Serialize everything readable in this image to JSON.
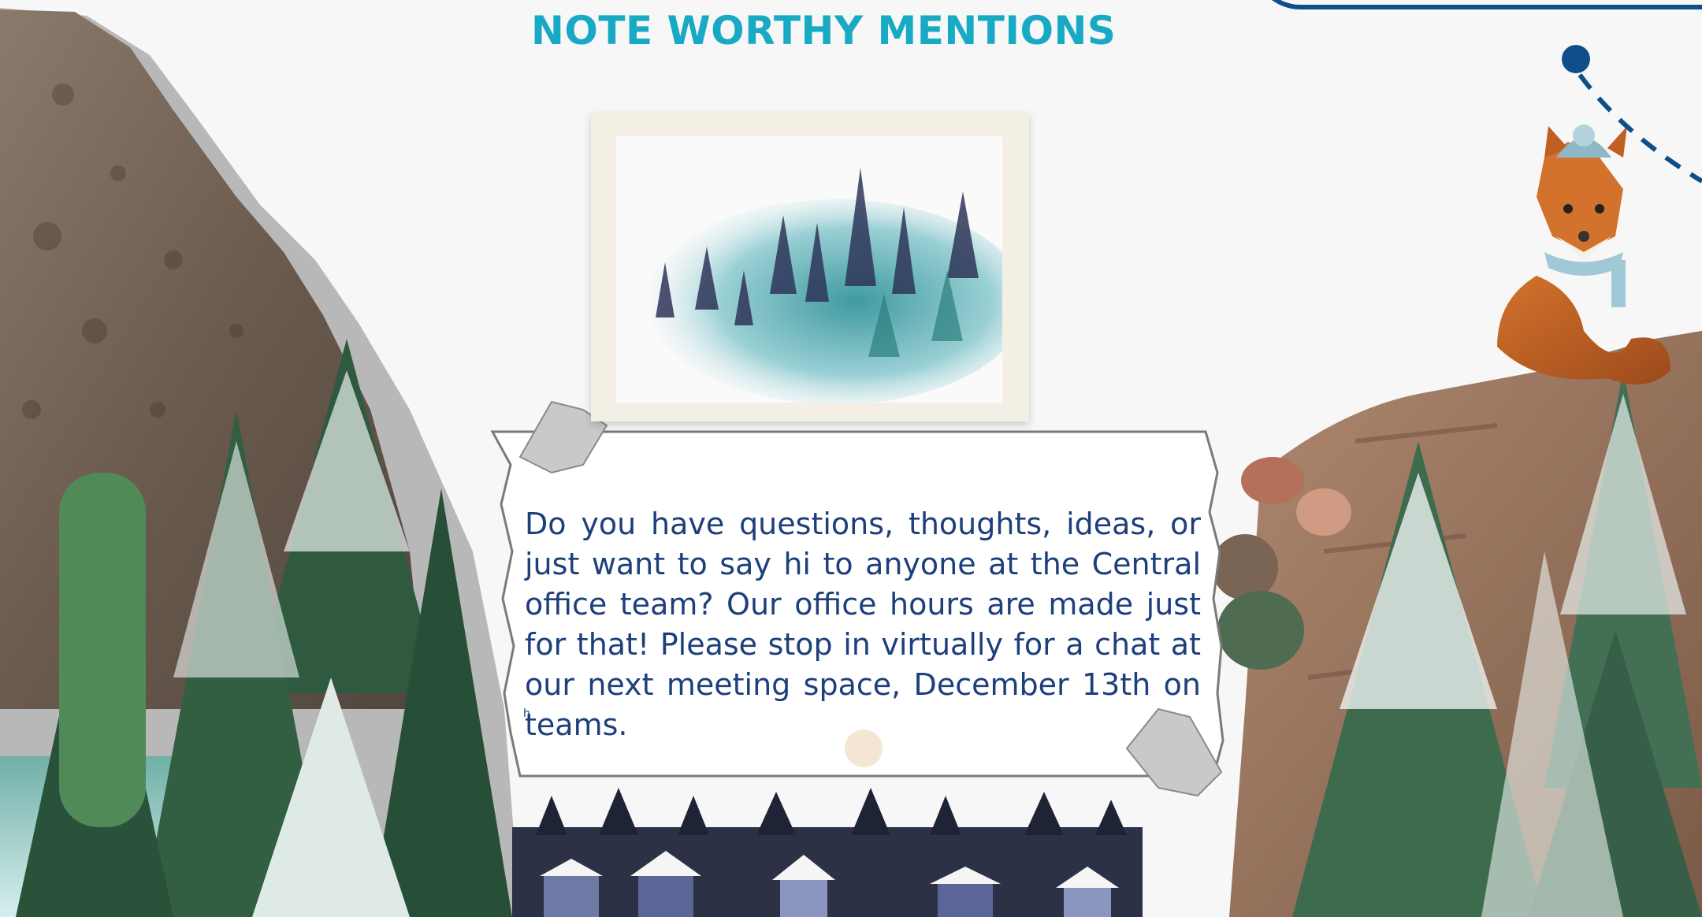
{
  "header": {
    "title": "NOTE WORTHY MENTIONS"
  },
  "note": {
    "message": "Do you have questions, thoughts, ideas, or just want to say hi to anyone at the Central office team? Our office hours are made just for that! Please stop in virtually for a chat at our next meeting space, December  13th on teams.",
    "stray_char": "h"
  },
  "colors": {
    "title": "#18a9c4",
    "body_text": "#1d3f7c",
    "accent_line": "#0f4e8a",
    "background": "#f7f7f7"
  },
  "icons": [
    "fox-icon",
    "winter-hat-icon",
    "pine-tree-icon",
    "house-icon",
    "mountain-rock-icon",
    "cactus-icon"
  ]
}
